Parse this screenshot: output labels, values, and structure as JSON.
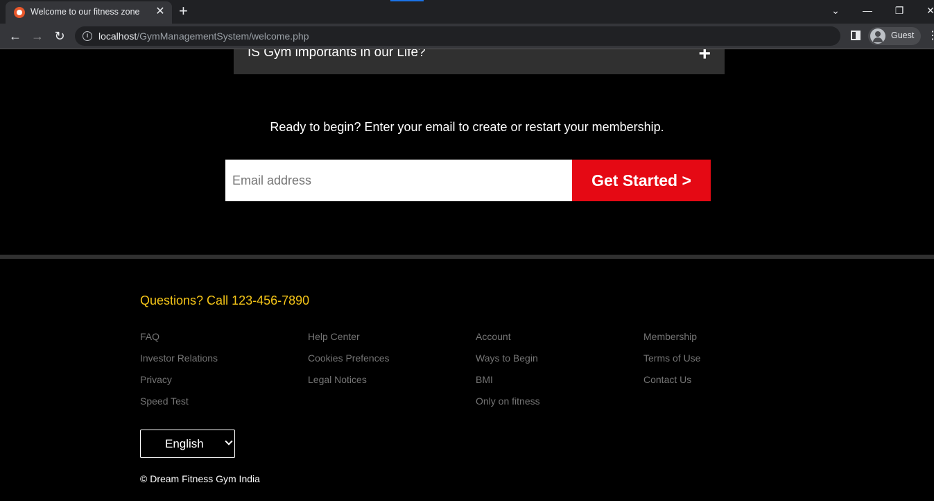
{
  "browser": {
    "tab_title": "Welcome to our fitness zone",
    "tab_close": "✕",
    "new_tab": "+",
    "url_host": "localhost",
    "url_path": "/GymManagementSystem/welcome.php",
    "profile_label": "Guest",
    "window_controls": {
      "tab_search": "⌄",
      "minimize": "—",
      "restore": "❐",
      "close": "✕"
    },
    "nav": {
      "back": "←",
      "forward": "→",
      "reload": "↻"
    },
    "menu": "⋮"
  },
  "faq": {
    "question": "IS Gym importants in our Life?",
    "expand_symbol": "+"
  },
  "cta": {
    "text": "Ready to begin? Enter your email to create or restart your membership.",
    "email_placeholder": "Email address",
    "button_label": "Get Started >"
  },
  "footer": {
    "questions": "Questions? Call 123-456-7890",
    "columns": [
      [
        "FAQ",
        "Investor Relations",
        "Privacy",
        "Speed Test"
      ],
      [
        "Help Center",
        "Cookies Prefences",
        "Legal Notices"
      ],
      [
        "Account",
        "Ways to Begin",
        "BMI",
        "Only on fitness"
      ],
      [
        "Membership",
        "Terms of Use",
        "Contact Us"
      ]
    ],
    "language": "English",
    "copyright": "© Dream Fitness Gym India"
  },
  "colors": {
    "accent_red": "#e50914",
    "questions_yellow": "#f5c518",
    "link_gray": "#757575",
    "faq_bg": "#303030"
  }
}
